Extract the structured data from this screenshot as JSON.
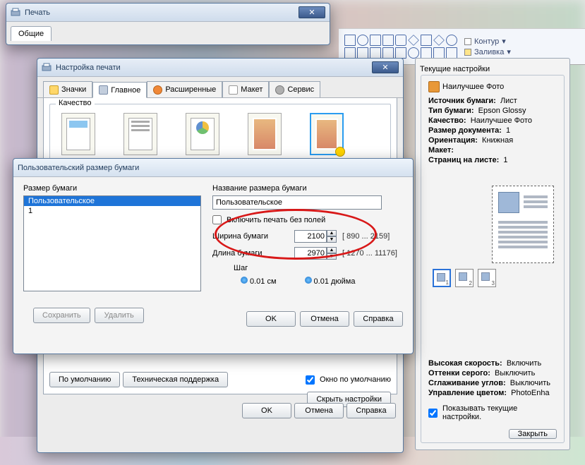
{
  "ribbon": {
    "contour": "Контур",
    "fill": "Заливка"
  },
  "print_win": {
    "title": "Печать",
    "tab_general": "Общие"
  },
  "settings": {
    "heading": "Текущие настройки",
    "best_photo": "Наилучшее Фото",
    "rows": {
      "source_k": "Источник бумаги:",
      "source_v": "Лист",
      "type_k": "Тип бумаги:",
      "type_v": "Epson Glossy",
      "quality_k": "Качество:",
      "quality_v": "Наилучшее Фото",
      "size_k": "Размер документа:",
      "size_v": "1",
      "orient_k": "Ориентация:",
      "orient_v": "Книжная",
      "layout_k": "Макет:",
      "ppp_k": "Страниц на листе:",
      "ppp_v": "1",
      "speed_k": "Высокая скорость:",
      "speed_v": "Включить",
      "gray_k": "Оттенки серого:",
      "gray_v": "Выключить",
      "smooth_k": "Сглаживание углов:",
      "smooth_v": "Выключить",
      "color_k": "Управление цветом:",
      "color_v": "PhotoEnha"
    },
    "show_current": "Показывать текущие настройки.",
    "close": "Закрыть"
  },
  "setup": {
    "title": "Настройка печати",
    "tabs": {
      "icons": "Значки",
      "main": "Главное",
      "advanced": "Расширенные",
      "layout": "Макет",
      "service": "Сервис"
    },
    "quality_group": "Качество",
    "default_btn": "По умолчанию",
    "support_btn": "Техническая поддержка",
    "hide_settings_btn": "Скрыть настройки",
    "default_window_chk": "Окно по умолчанию",
    "ok": "OK",
    "cancel": "Отмена",
    "help": "Справка"
  },
  "paper": {
    "title": "Пользовательский размер бумаги",
    "list_label": "Размер бумаги",
    "list_items": [
      "Пользовательское",
      "1"
    ],
    "name_label": "Название размера бумаги",
    "name_value": "Пользовательское",
    "borderless_chk": "Включить печать без полей",
    "width_label": "Ширина бумаги",
    "width_value": "2100",
    "width_range": "[   890 ... 2159]",
    "length_label": "Длина бумаги",
    "length_value": "2970",
    "length_range": "[ 1270 ... 11176]",
    "step_label": "Шаг",
    "step_cm": "0.01 см",
    "step_inch": "0.01 дюйма",
    "save": "Сохранить",
    "delete": "Удалить",
    "ok": "OK",
    "cancel": "Отмена",
    "help": "Справка"
  }
}
